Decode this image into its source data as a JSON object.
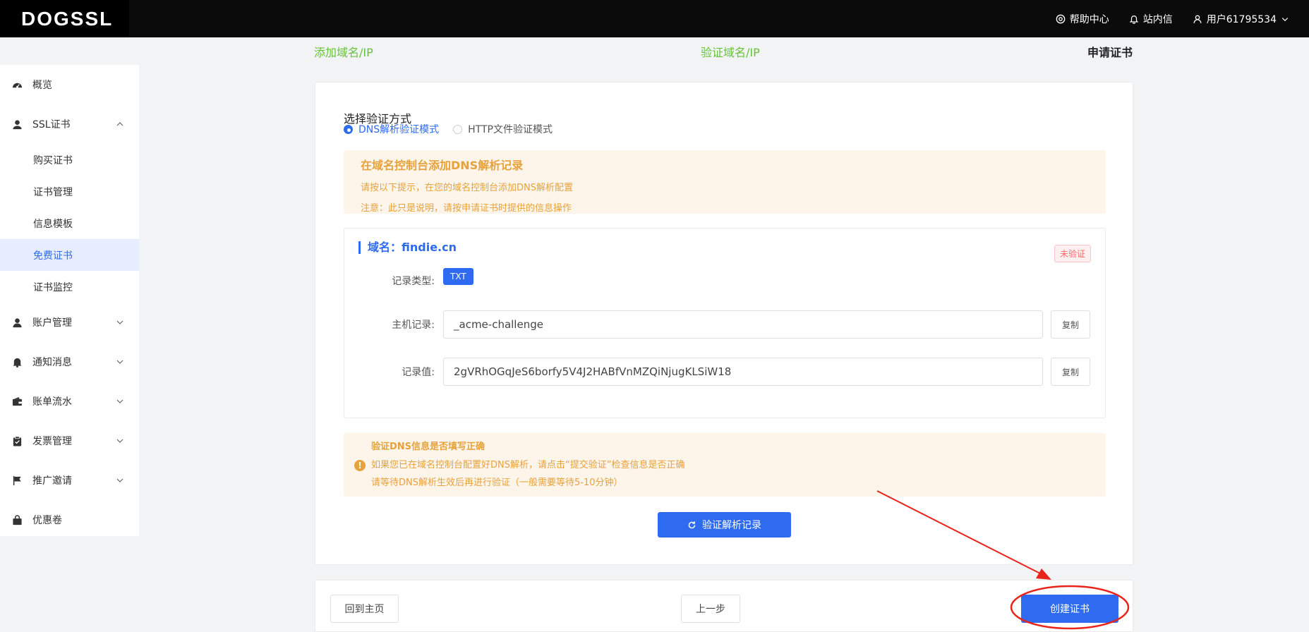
{
  "brand": {
    "logo_text": "DOGSSL"
  },
  "topbar": {
    "help": "帮助中心",
    "inbox": "站内信",
    "user": "用户61795534"
  },
  "sidebar": {
    "items": [
      {
        "label": "概览",
        "icon": "dashboard-icon"
      },
      {
        "label": "SSL证书",
        "icon": "user-cert-icon",
        "expanded": true,
        "children": [
          "购买证书",
          "证书管理",
          "信息模板",
          "免费证书",
          "证书监控"
        ],
        "active_child": "免费证书"
      },
      {
        "label": "账户管理",
        "icon": "person-icon"
      },
      {
        "label": "通知消息",
        "icon": "bell-icon"
      },
      {
        "label": "账单流水",
        "icon": "wallet-icon"
      },
      {
        "label": "发票管理",
        "icon": "clipboard-icon"
      },
      {
        "label": "推广邀请",
        "icon": "flag-icon"
      },
      {
        "label": "优惠卷",
        "icon": "bag-icon"
      }
    ]
  },
  "steps": {
    "step1": "添加域名/IP",
    "step2": "验证域名/IP",
    "step3": "申请证书"
  },
  "verify": {
    "section_title": "选择验证方式",
    "mode_dns": "DNS解析验证模式",
    "mode_http": "HTTP文件验证模式",
    "selected_mode": "DNS解析验证模式"
  },
  "notice": {
    "title": "在域名控制台添加DNS解析记录",
    "line1": "请按以下提示，在您的域名控制台添加DNS解析配置",
    "line2": "注意：此只是说明，请按申请证书时提供的信息操作"
  },
  "domain": {
    "title": "域名：findie.cn",
    "status": "未验证",
    "record_type_label": "记录类型:",
    "record_type": "TXT",
    "host_label": "主机记录:",
    "host_value": "_acme-challenge",
    "value_label": "记录值:",
    "record_value": "2gVRhOGqJeS6borfy5V4J2HABfVnMZQiNjugKLSiW18",
    "copy_label": "复制"
  },
  "warn": {
    "title": "验证DNS信息是否填写正确",
    "line1": "如果您已在域名控制台配置好DNS解析，请点击“提交验证”检查信息是否正确",
    "line2": "请等待DNS解析生效后再进行验证（一般需要等待5-10分钟）"
  },
  "verify_button": "验证解析记录",
  "footer": {
    "home": "回到主页",
    "prev": "上一步",
    "create": "创建证书"
  },
  "colors": {
    "primary": "#2e6bf0",
    "success": "#67c23a",
    "warning": "#e6a23c",
    "danger": "#f56c6c",
    "annotation": "#e8241b"
  }
}
